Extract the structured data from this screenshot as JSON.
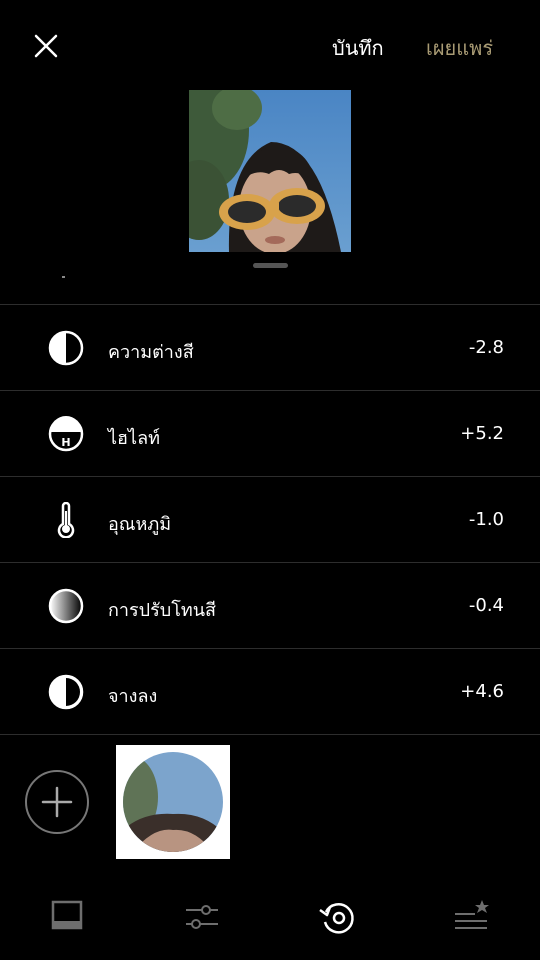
{
  "header": {
    "close_icon": "close-icon",
    "save_label": "บันทึก",
    "publish_label": "เผยแพร่",
    "publish_color": "#a99b74"
  },
  "adjustments": [
    {
      "icon": "contrast-icon",
      "label": "ความต่างสี",
      "value": "-2.8"
    },
    {
      "icon": "highlight-icon",
      "label": "ไฮไลท์",
      "value": "+5.2"
    },
    {
      "icon": "thermometer-icon",
      "label": "อุณหภูมิ",
      "value": "-1.0"
    },
    {
      "icon": "gradient-circle-icon",
      "label": "การปรับโทนสี",
      "value": "-0.4"
    },
    {
      "icon": "fade-icon",
      "label": "จางลง",
      "value": "+4.6"
    }
  ],
  "recipes": {
    "add_icon": "plus-circle-icon",
    "thumbnail": "recipe-thumbnail"
  },
  "bottom_nav": [
    {
      "icon": "presets-icon",
      "active": false
    },
    {
      "icon": "sliders-icon",
      "active": false
    },
    {
      "icon": "history-undo-icon",
      "active": true
    },
    {
      "icon": "recipes-icon",
      "active": false
    }
  ],
  "colors": {
    "background": "#000000",
    "divider": "#2d2d2d",
    "accent": "#a99b74",
    "inactive_icon": "#6e6e6e"
  }
}
